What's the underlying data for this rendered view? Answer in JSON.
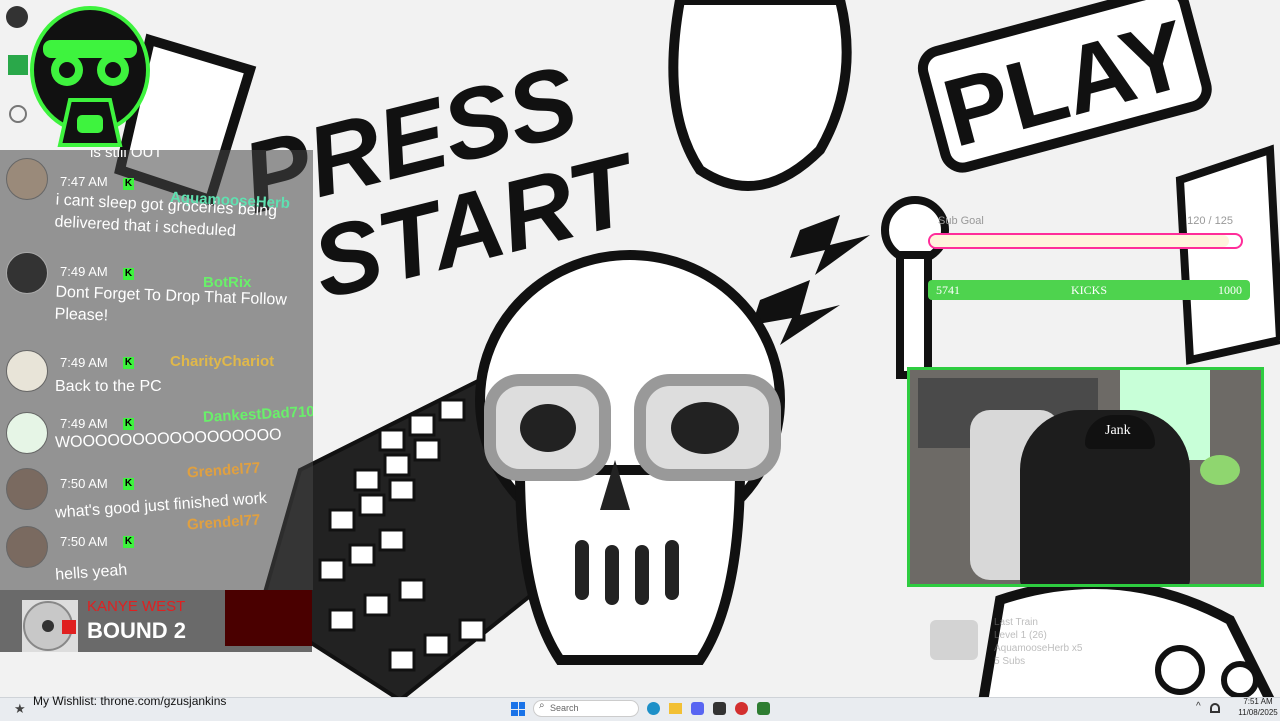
{
  "background_art": {
    "title_line1": "PRESS",
    "title_line2": "START",
    "play_sign": "PLAY"
  },
  "goals": {
    "sub_goal": {
      "label": "Sub Goal",
      "count": "120 / 125",
      "progress": 0.96
    },
    "kicks": {
      "current": "5741",
      "label": "KICKS",
      "target": "1000",
      "progress": 1.0
    }
  },
  "chat": {
    "partial_top": "is still OUT",
    "messages": [
      {
        "time": "7:47 AM",
        "user": "AquamooseHerb",
        "color": "#5fe0b0",
        "lines": [
          "i cant sleep got groceries being",
          "delivered that i scheduled"
        ]
      },
      {
        "time": "7:49 AM",
        "user": "BotRix",
        "color": "#69f06a",
        "lines": [
          "Dont Forget To Drop That Follow",
          "Please!"
        ]
      },
      {
        "time": "7:49 AM",
        "user": "CharityChariot",
        "color": "#e0b84a",
        "lines": [
          "Back to the PC"
        ]
      },
      {
        "time": "7:49 AM",
        "user": "DankestDad710",
        "color": "#69f06a",
        "lines": [
          "WOOOOOOOOOOOOOOOOO"
        ]
      },
      {
        "time": "7:50 AM",
        "user": "Grendel77",
        "color": "#e0a040",
        "lines": [
          "what's good just finished work"
        ]
      },
      {
        "time": "7:50 AM",
        "user": "Grendel77",
        "color": "#e0a040",
        "lines": [
          "hells yeah"
        ]
      }
    ]
  },
  "now_playing": {
    "artist": "KANYE WEST",
    "song": "BOUND 2"
  },
  "webcam": {
    "cap_text": "Jank"
  },
  "recent": {
    "l1": "Last Train",
    "l2": "Level 1 (26)",
    "l3": "AquamooseHerb x5",
    "l4": "5 Subs"
  },
  "taskbar": {
    "wishlist": "My Wishlist: throne.com/gzusjankins",
    "search_placeholder": "Search",
    "clock_time": "7:51 AM",
    "clock_date": "11/08/2025"
  },
  "colors": {
    "accent": "#3ef33e",
    "sub_bar": "#ff2d9a",
    "kicks_bar": "#4ed34e"
  }
}
